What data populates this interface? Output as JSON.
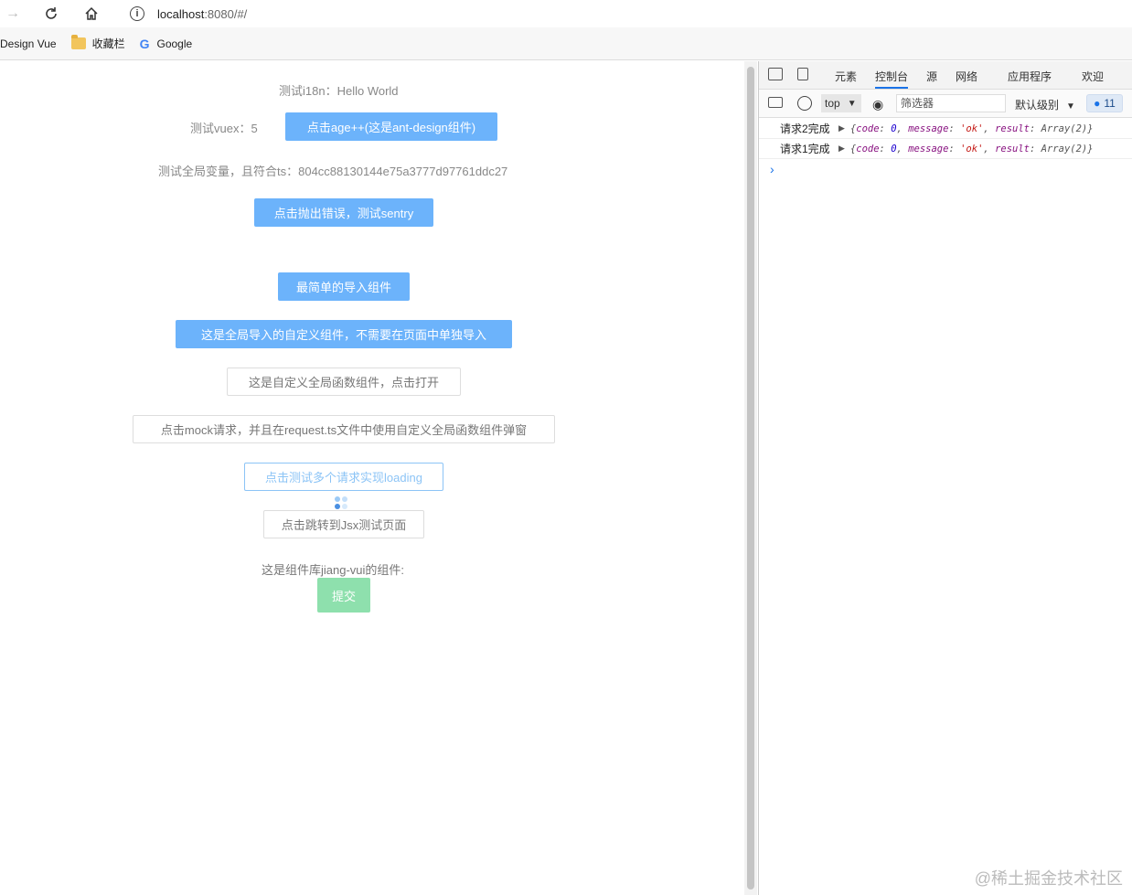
{
  "browser": {
    "url_host": "localhost",
    "url_rest": ":8080/#/"
  },
  "bookmarks": [
    {
      "label": "Design Vue"
    },
    {
      "label": "收藏栏"
    },
    {
      "label": "Google"
    }
  ],
  "page": {
    "i18n_text": "测试i18n：Hello World",
    "vuex_text": "测试vuex：5",
    "age_button": "点击age++(这是ant-design组件)",
    "global_var_text": "测试全局变量，且符合ts：804cc88130144e75a3777d97761ddc27",
    "sentry_button": "点击抛出错误，测试sentry",
    "simple_import_button": "最简单的导入组件",
    "global_component_button": "这是全局导入的自定义组件，不需要在页面中单独导入",
    "global_func_button": "这是自定义全局函数组件，点击打开",
    "mock_button": "点击mock请求，并且在request.ts文件中使用自定义全局函数组件弹窗",
    "loading_button": "点击测试多个请求实现loading",
    "jsx_button": "点击跳转到Jsx测试页面",
    "lib_text": "这是组件库jiang-vui的组件:",
    "submit_button": "提交"
  },
  "devtools": {
    "tabs": [
      "元素",
      "控制台",
      "源",
      "网络",
      "应用程序",
      "欢迎"
    ],
    "active_tab": "控制台",
    "context": "top",
    "filter_placeholder": "筛选器",
    "level": "默认级别",
    "badge_count": "11",
    "logs": [
      {
        "message": "请求2完成",
        "code": "0",
        "msg": "'ok'",
        "result": "Array(2)"
      },
      {
        "message": "请求1完成",
        "code": "0",
        "msg": "'ok'",
        "result": "Array(2)"
      }
    ]
  },
  "watermark": "@稀土掘金技术社区"
}
